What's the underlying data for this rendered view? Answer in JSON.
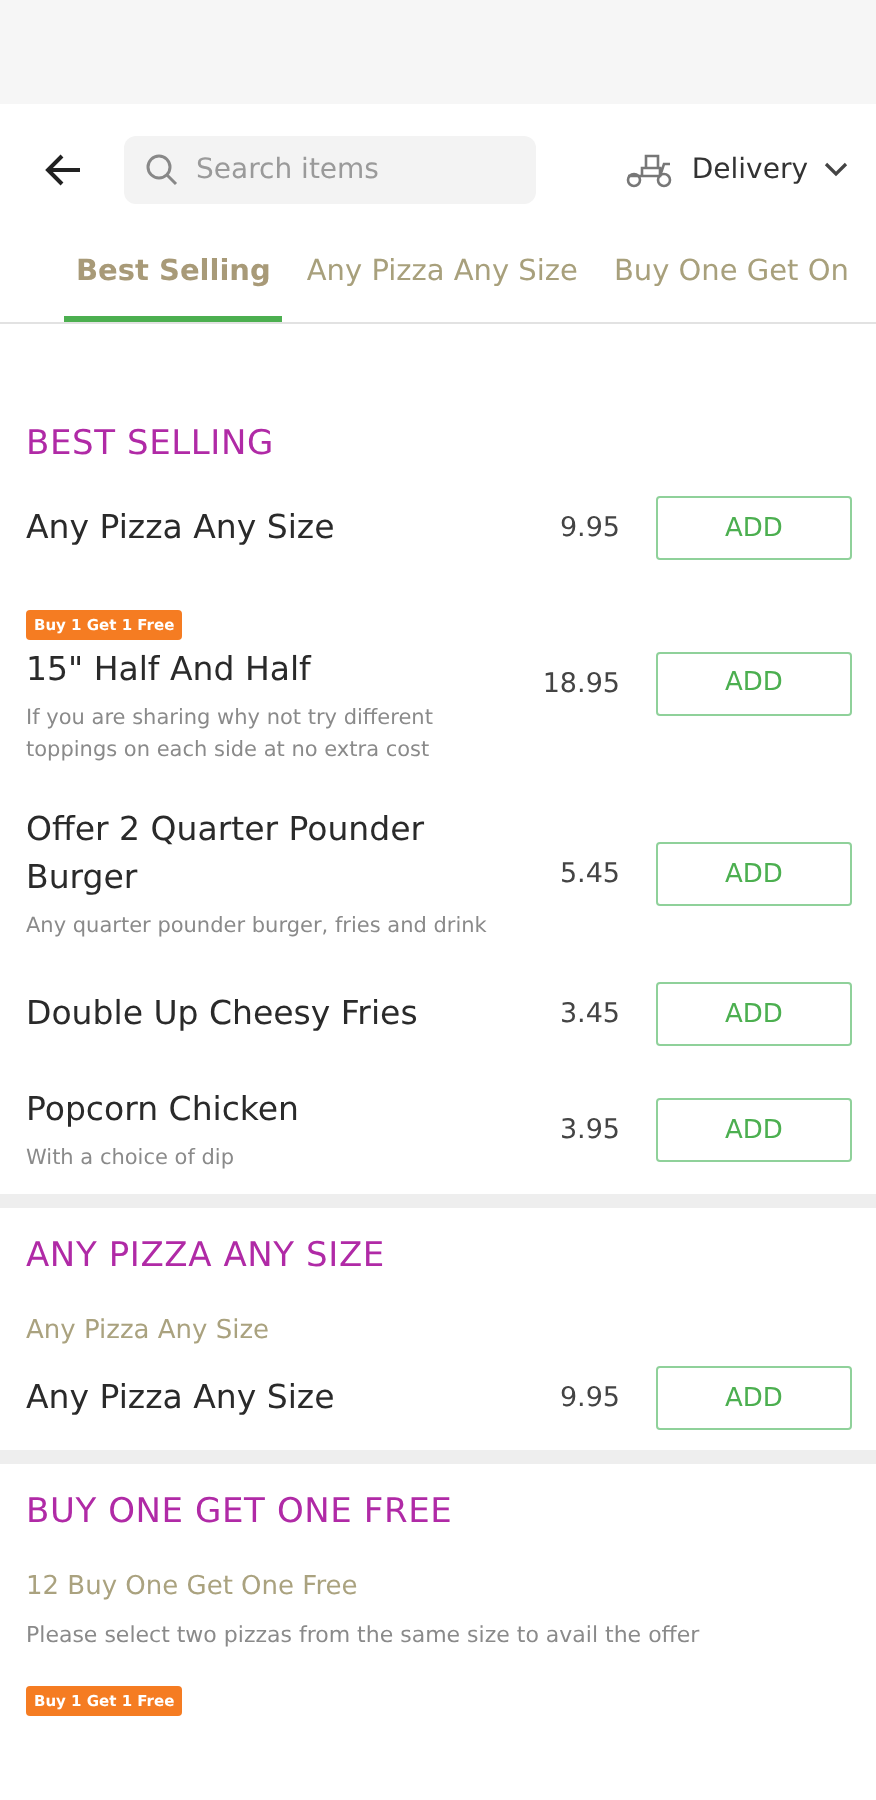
{
  "header": {
    "search": {
      "placeholder": "Search items"
    },
    "mode": "Delivery"
  },
  "tabs": [
    {
      "label": "Best Selling",
      "selected": true
    },
    {
      "label": "Any Pizza Any Size",
      "selected": false
    },
    {
      "label": "Buy One Get On",
      "selected": false
    }
  ],
  "sections": [
    {
      "title": "BEST SELLING",
      "items": [
        {
          "name": "Any Pizza Any Size",
          "price": "9.95",
          "button": "ADD"
        },
        {
          "badge": "Buy 1 Get 1 Free",
          "name": "15\" Half And Half",
          "description": "If you are sharing why not try different toppings on each side at no extra cost",
          "price": "18.95",
          "button": "ADD"
        },
        {
          "name": "Offer 2 Quarter Pounder Burger",
          "description": "Any quarter pounder burger, fries and drink",
          "price": "5.45",
          "button": "ADD"
        },
        {
          "name": "Double Up Cheesy Fries",
          "price": "3.45",
          "button": "ADD"
        },
        {
          "name": "Popcorn Chicken",
          "description": "With a choice of dip",
          "price": "3.95",
          "button": "ADD"
        }
      ]
    },
    {
      "title": "ANY PIZZA ANY SIZE",
      "subtitle": "Any Pizza Any Size",
      "items": [
        {
          "name": "Any Pizza Any Size",
          "price": "9.95",
          "button": "ADD"
        }
      ]
    },
    {
      "title": "BUY ONE GET ONE FREE",
      "subtitle": "12 Buy One Get One Free",
      "note": "Please select two pizzas from the same size to avail the offer",
      "items": [
        {
          "badge": "Buy 1 Get 1 Free"
        }
      ]
    }
  ]
}
